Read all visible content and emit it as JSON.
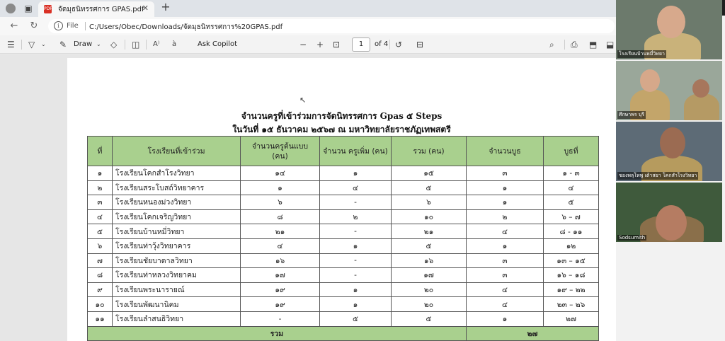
{
  "browser": {
    "tab_title": "จัดมุธนิทรรศการ GPAS.pdf",
    "file_label": "File",
    "url": "C:/Users/Obec/Downloads/จัดมุธนิทรรศการ%20GPAS.pdf"
  },
  "pdf_toolbar": {
    "draw_label": "Draw",
    "copilot_label": "Ask Copilot",
    "page_current": "1",
    "page_total": "of 4",
    "zoom_out": "−",
    "zoom_in": "+"
  },
  "document": {
    "title_line1": "จำนวนครูที่เข้าร่วมการจัดนิทรรศการ Gpas ๕ Steps",
    "title_line2": "ในวันที่ ๑๕ ธันวาคม ๒๕๖๗ ณ มหาวิทยาลัยราชภัฏเทพสตรี",
    "headers": [
      "ที่",
      "โรงเรียนที่เข้าร่วม",
      "จำนวนครูต้นแบบ (คน)",
      "จำนวน ครูเพิ่ม (คน)",
      "รวม (คน)",
      "จำนวนบูธ",
      "บูธที่"
    ],
    "rows": [
      [
        "๑",
        "โรงเรียนโคกสำโรงวิทยา",
        "๑๔",
        "๑",
        "๑๕",
        "๓",
        "๑ - ๓"
      ],
      [
        "๒",
        "โรงเรียนสระโบสถ์วิทยาคาร",
        "๑",
        "๔",
        "๕",
        "๑",
        "๔"
      ],
      [
        "๓",
        "โรงเรียนหนองม่วงวิทยา",
        "๖",
        "-",
        "๖",
        "๑",
        "๕"
      ],
      [
        "๔",
        "โรงเรียนโคกเจริญวิทยา",
        "๘",
        "๒",
        "๑๐",
        "๒",
        "๖ – ๗"
      ],
      [
        "๕",
        "โรงเรียนบ้านหมี่วิทยา",
        "๒๑",
        "-",
        "๒๑",
        "๔",
        "๘ - ๑๑"
      ],
      [
        "๖",
        "โรงเรียนท่าวุ้งวิทยาคาร",
        "๔",
        "๑",
        "๕",
        "๑",
        "๑๒"
      ],
      [
        "๗",
        "โรงเรียนชัยบาดาลวิทยา",
        "๑๖",
        "-",
        "๑๖",
        "๓",
        "๑๓ – ๑๕"
      ],
      [
        "๘",
        "โรงเรียนท่าหลวงวิทยาคม",
        "๑๗",
        "-",
        "๑๗",
        "๓",
        "๑๖ – ๑๘"
      ],
      [
        "๙",
        "โรงเรียนพระนารายณ์",
        "๑๙",
        "๑",
        "๒๐",
        "๔",
        "๑๙ – ๒๒"
      ],
      [
        "๑๐",
        "โรงเรียนพัฒนานิคม",
        "๑๙",
        "๑",
        "๒๐",
        "๔",
        "๒๓ – ๒๖"
      ],
      [
        "๑๑",
        "โรงเรียนลำสนธิวิทยา",
        "-",
        "๕",
        "๕",
        "๑",
        "๒๗"
      ]
    ],
    "total_label": "รวม",
    "total_booths": "๒๗"
  },
  "video_tiles": [
    {
      "name": "โรงเรียนบ้านหมี่วิทยา"
    },
    {
      "name": "ศึกษาพร บุรี"
    },
    {
      "name": "ชองพลุโหพู เต้าสยา โคกสำโรงวิทยา"
    },
    {
      "name": "Sodsumith"
    }
  ],
  "colors": {
    "header_green": "#a9d08e",
    "pdf_red": "#d93025",
    "window_controls": "#1f1f1f"
  }
}
